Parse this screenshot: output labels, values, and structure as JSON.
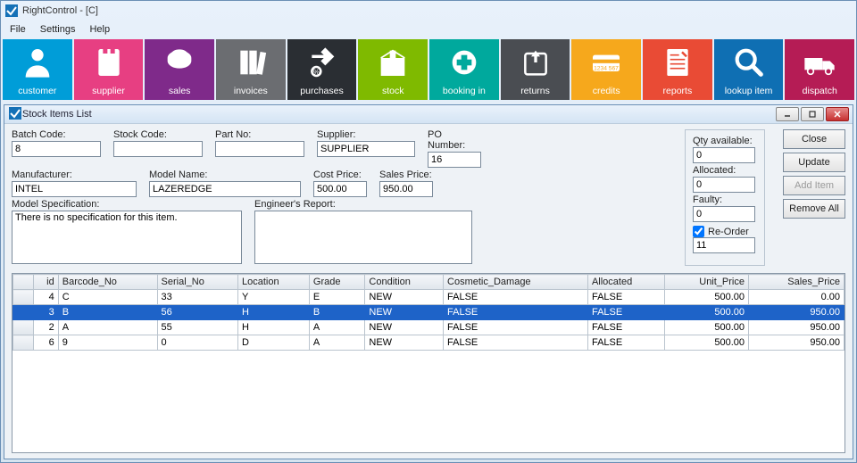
{
  "app": {
    "title": "RightControl - [C]"
  },
  "menu": [
    "File",
    "Settings",
    "Help"
  ],
  "tiles": [
    {
      "label": "customer",
      "color": "#009dd8"
    },
    {
      "label": "supplier",
      "color": "#e73f82"
    },
    {
      "label": "sales",
      "color": "#7f2a8a"
    },
    {
      "label": "invoices",
      "color": "#6b6d71"
    },
    {
      "label": "purchases",
      "color": "#2a2e33"
    },
    {
      "label": "stock",
      "color": "#7fba00"
    },
    {
      "label": "booking in",
      "color": "#00a99d"
    },
    {
      "label": "returns",
      "color": "#4a4d52"
    },
    {
      "label": "credits",
      "color": "#f6a81c"
    },
    {
      "label": "reports",
      "color": "#e94b35"
    },
    {
      "label": "lookup item",
      "color": "#0f6fb3"
    },
    {
      "label": "dispatch",
      "color": "#b51c55"
    }
  ],
  "child": {
    "title": "Stock Items List"
  },
  "form": {
    "batch_code": {
      "label": "Batch Code:",
      "value": "8"
    },
    "stock_code": {
      "label": "Stock Code:",
      "value": ""
    },
    "part_no": {
      "label": "Part No:",
      "value": ""
    },
    "supplier": {
      "label": "Supplier:",
      "value": "SUPPLIER"
    },
    "po_number": {
      "label": "PO Number:",
      "value": "16"
    },
    "manufacturer": {
      "label": "Manufacturer:",
      "value": "INTEL"
    },
    "model_name": {
      "label": "Model Name:",
      "value": "LAZEREDGE"
    },
    "cost_price": {
      "label": "Cost Price:",
      "value": "500.00"
    },
    "sales_price": {
      "label": "Sales Price:",
      "value": "950.00"
    },
    "model_spec": {
      "label": "Model Specification:",
      "value": "There is no specification for this item."
    },
    "eng_report": {
      "label": "Engineer's Report:",
      "value": ""
    }
  },
  "side": {
    "qty_available": {
      "label": "Qty available:",
      "value": "0"
    },
    "allocated": {
      "label": "Allocated:",
      "value": "0"
    },
    "faulty": {
      "label": "Faulty:",
      "value": "0"
    },
    "reorder": {
      "label": "Re-Order",
      "checked": true,
      "value": "11"
    }
  },
  "buttons": {
    "close": "Close",
    "update": "Update",
    "add_item": "Add Item",
    "remove_all": "Remove All"
  },
  "table": {
    "columns": [
      "id",
      "Barcode_No",
      "Serial_No",
      "Location",
      "Grade",
      "Condition",
      "Cosmetic_Damage",
      "Allocated",
      "Unit_Price",
      "Sales_Price"
    ],
    "rows": [
      {
        "sel": false,
        "cells": [
          "4",
          "C",
          "33",
          "Y",
          "E",
          "NEW",
          "FALSE",
          "FALSE",
          "500.00",
          "0.00"
        ]
      },
      {
        "sel": true,
        "cells": [
          "3",
          "B",
          "56",
          "H",
          "B",
          "NEW",
          "FALSE",
          "FALSE",
          "500.00",
          "950.00"
        ]
      },
      {
        "sel": false,
        "cells": [
          "2",
          "A",
          "55",
          "H",
          "A",
          "NEW",
          "FALSE",
          "FALSE",
          "500.00",
          "950.00"
        ]
      },
      {
        "sel": false,
        "cells": [
          "6",
          "9",
          "0",
          "D",
          "A",
          "NEW",
          "FALSE",
          "FALSE",
          "500.00",
          "950.00"
        ]
      }
    ]
  }
}
